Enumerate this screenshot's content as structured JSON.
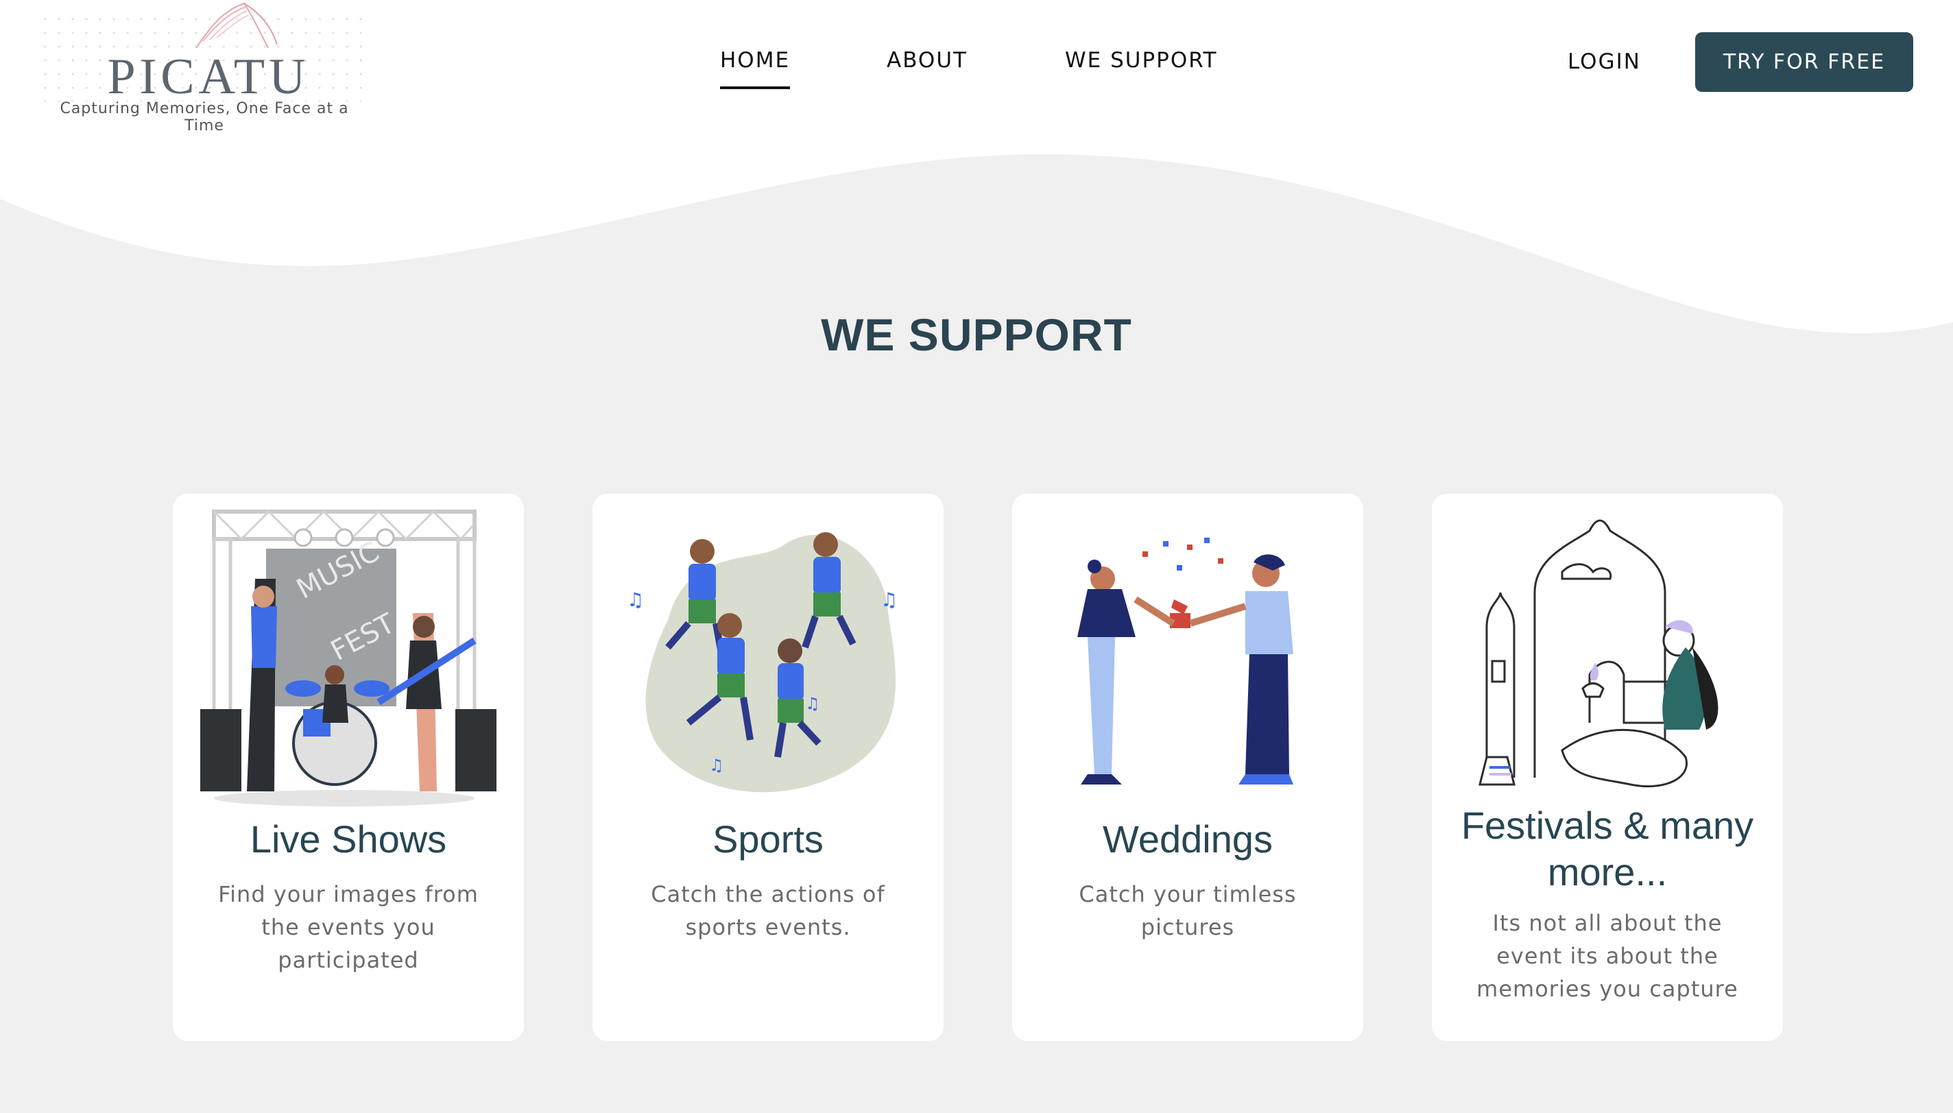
{
  "brand": {
    "name": "PICATU",
    "tagline": "Capturing Memories, One Face at a Time"
  },
  "nav": {
    "items": [
      {
        "label": "HOME",
        "active": true
      },
      {
        "label": "ABOUT",
        "active": false
      },
      {
        "label": "WE SUPPORT",
        "active": false
      }
    ],
    "login_label": "LOGIN",
    "cta_label": "TRY FOR FREE"
  },
  "section": {
    "title": "WE SUPPORT"
  },
  "cards": [
    {
      "title": "Live Shows",
      "description": "Find your images from the events you participated",
      "illustration": "music-fest-band-illustration"
    },
    {
      "title": "Sports",
      "description": "Catch the actions of sports events.",
      "illustration": "football-players-illustration"
    },
    {
      "title": "Weddings",
      "description": "Catch your timless pictures",
      "illustration": "proposal-couple-illustration"
    },
    {
      "title": "Festivals & many more...",
      "description": "Its not all about the event its about the memories you capture",
      "illustration": "diwali-lamp-illustration"
    }
  ],
  "colors": {
    "background": "#f0f0f0",
    "primary": "#2b4a55",
    "heading": "#284652",
    "accent_blue": "#3f6fe0",
    "navy": "#1e2a6b"
  }
}
